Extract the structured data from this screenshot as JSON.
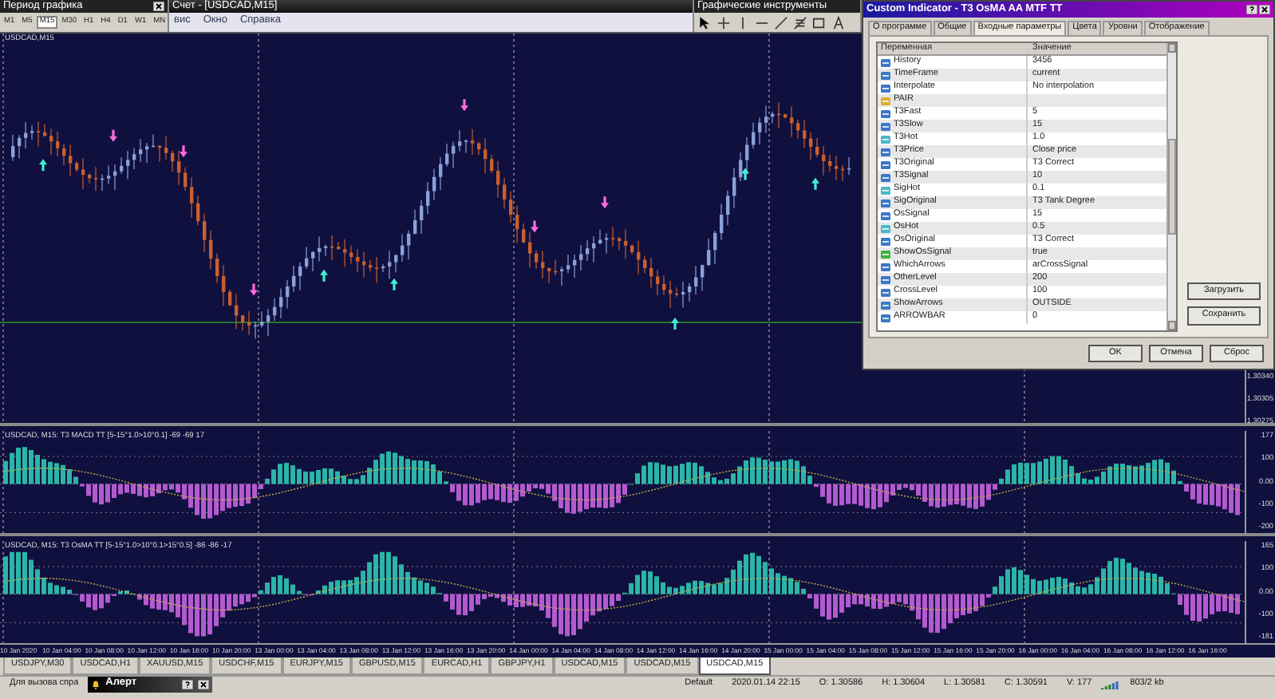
{
  "period_toolbar": {
    "title": "Период графика",
    "buttons": [
      {
        "label": "M1",
        "selected": false
      },
      {
        "label": "M5",
        "selected": false
      },
      {
        "label": "M15",
        "selected": true
      },
      {
        "label": "M30",
        "selected": false
      },
      {
        "label": "H1",
        "selected": false
      },
      {
        "label": "H4",
        "selected": false
      },
      {
        "label": "D1",
        "selected": false
      },
      {
        "label": "W1",
        "selected": false
      },
      {
        "label": "MN",
        "selected": false
      }
    ]
  },
  "main_window": {
    "title": "Счет - [USDCAD,M15]",
    "menu": [
      "вис",
      "Окно",
      "Справка"
    ]
  },
  "drawing_toolbar": {
    "title": "Графические инструменты"
  },
  "chart": {
    "symbol": "USDCAD,M15",
    "price_axis": [
      "1.30340",
      "1.30305",
      "1.30275"
    ],
    "indicators": [
      {
        "label": "USDCAD, M15: T3 MACD TT [5-15°1.0>10°0.1] -69 -69 17",
        "axis": [
          "177",
          "100",
          "0.00",
          "-100",
          "-200"
        ]
      },
      {
        "label": "USDCAD, M15: T3 OsMA TT [5-15°1.0>10°0.1>15°0.5] -86 -86 -17",
        "axis": [
          "165",
          "100",
          "0.00",
          "-100",
          "-181"
        ]
      }
    ],
    "time_axis": [
      "10 Jan 2020",
      "10 Jan 04:00",
      "10 Jan 08:00",
      "10 Jan 12:00",
      "10 Jan 16:00",
      "10 Jan 20:00",
      "13 Jan 00:00",
      "13 Jan 04:00",
      "13 Jan 08:00",
      "13 Jan 12:00",
      "13 Jan 16:00",
      "13 Jan 20:00",
      "14 Jan 00:00",
      "14 Jan 04:00",
      "14 Jan 08:00",
      "14 Jan 12:00",
      "14 Jan 16:00",
      "14 Jan 20:00",
      "15 Jan 00:00",
      "15 Jan 04:00",
      "15 Jan 08:00",
      "15 Jan 12:00",
      "15 Jan 16:00",
      "15 Jan 20:00",
      "16 Jan 00:00",
      "16 Jan 04:00",
      "16 Jan 08:00",
      "16 Jan 12:00",
      "16 Jan 16:00"
    ]
  },
  "chart_tabs": [
    {
      "label": "USDJPY,M30",
      "selected": false
    },
    {
      "label": "USDCAD,H1",
      "selected": false
    },
    {
      "label": "XAUUSD,M15",
      "selected": false
    },
    {
      "label": "USDCHF,M15",
      "selected": false
    },
    {
      "label": "EURJPY,M15",
      "selected": false
    },
    {
      "label": "GBPUSD,M15",
      "selected": false
    },
    {
      "label": "EURCAD,H1",
      "selected": false
    },
    {
      "label": "GBPJPY,H1",
      "selected": false
    },
    {
      "label": "USDCAD,M15",
      "selected": false
    },
    {
      "label": "USDCAD,M15",
      "selected": false
    },
    {
      "label": "USDCAD,M15",
      "selected": true
    }
  ],
  "status_bar": {
    "help": "Для вызова спра",
    "alert_window": {
      "title": "Алерт"
    },
    "profile": "Default",
    "time": "2020.01.14 22:15",
    "open": "O: 1.30586",
    "high": "H: 1.30604",
    "low": "L: 1.30581",
    "close": "C: 1.30591",
    "volume": "V: 177",
    "traffic": "803/2 kb"
  },
  "dialog": {
    "title": "Custom Indicator - T3 OsMA AA MTF TT",
    "tabs": [
      {
        "label": "О программе",
        "selected": false
      },
      {
        "label": "Общие",
        "selected": false
      },
      {
        "label": "Входные параметры",
        "selected": true
      },
      {
        "label": "Цвета",
        "selected": false
      },
      {
        "label": "Уровни",
        "selected": false
      },
      {
        "label": "Отображение",
        "selected": false
      }
    ],
    "columns": [
      "Переменная",
      "Значение"
    ],
    "rows": [
      {
        "kind": "int",
        "name": "History",
        "value": "3456"
      },
      {
        "kind": "int",
        "name": "TimeFrame",
        "value": "current"
      },
      {
        "kind": "int",
        "name": "Interpolate",
        "value": "No interpolation"
      },
      {
        "kind": "string",
        "name": "PAIR"
      },
      {
        "kind": "int",
        "name": "T3Fast",
        "value": "5"
      },
      {
        "kind": "int",
        "name": "T3Slow",
        "value": "15"
      },
      {
        "kind": "double",
        "name": "T3Hot",
        "value": "1.0"
      },
      {
        "kind": "int",
        "name": "T3Price",
        "value": "Close price"
      },
      {
        "kind": "int",
        "name": "T3Original",
        "value": "T3 Correct"
      },
      {
        "kind": "int",
        "name": "T3Signal",
        "value": "10"
      },
      {
        "kind": "double",
        "name": "SigHot",
        "value": "0.1"
      },
      {
        "kind": "int",
        "name": "SigOriginal",
        "value": "T3 Tank Degree"
      },
      {
        "kind": "int",
        "name": "OsSignal",
        "value": "15"
      },
      {
        "kind": "double",
        "name": "OsHot",
        "value": "0.5"
      },
      {
        "kind": "int",
        "name": "OsOriginal",
        "value": "T3 Correct"
      },
      {
        "kind": "bool",
        "name": "ShowOsSignal",
        "value": "true"
      },
      {
        "kind": "int",
        "name": "WhichArrows",
        "value": "arCrossSignal"
      },
      {
        "kind": "int",
        "name": "OtherLevel",
        "value": "200"
      },
      {
        "kind": "int",
        "name": "CrossLevel",
        "value": "100"
      },
      {
        "kind": "int",
        "name": "ShowArrows",
        "value": "OUTSIDE"
      },
      {
        "kind": "int",
        "name": "ARROWBAR",
        "value": "0"
      }
    ],
    "side_buttons": [
      "Загрузить",
      "Сохранить"
    ],
    "buttons": [
      "OK",
      "Отмена",
      "Сброс"
    ]
  }
}
